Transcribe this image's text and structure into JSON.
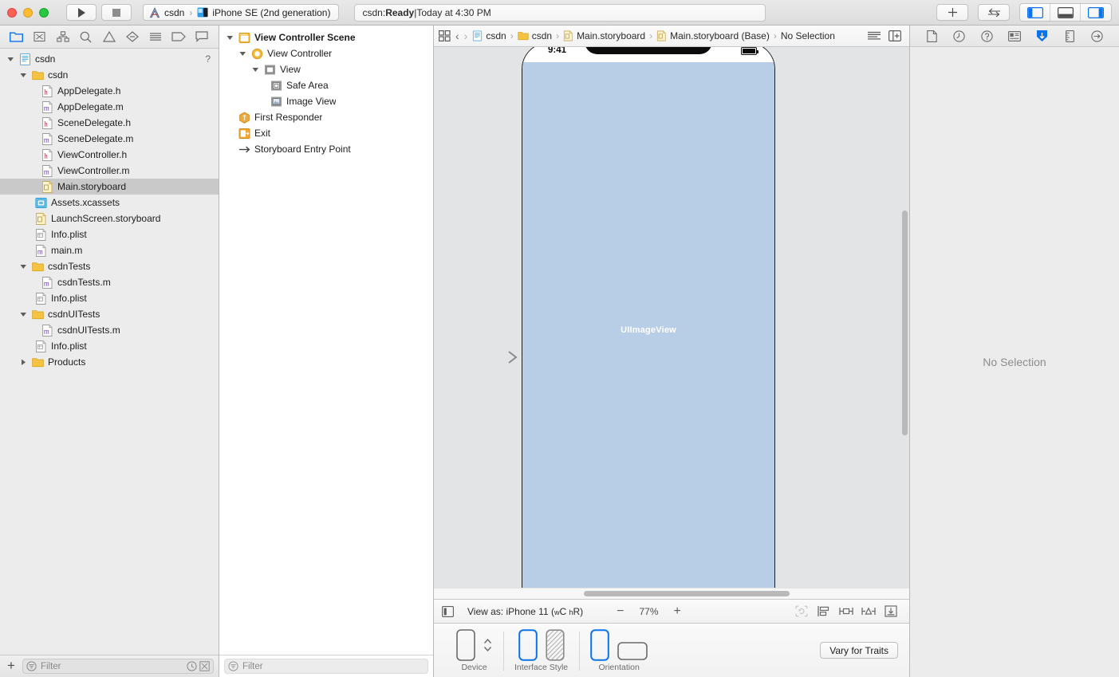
{
  "titlebar": {
    "window_controls": [
      "close",
      "minimize",
      "zoom"
    ],
    "run_button": "run-icon",
    "stop_button": "stop-icon",
    "scheme": {
      "project": "csdn",
      "separator": "›",
      "destination": "iPhone SE (2nd generation)"
    },
    "status": {
      "prefix": "csdn: ",
      "state": "Ready",
      "divider": " | ",
      "time": "Today at 4:30 PM"
    },
    "add_button": "plus-icon",
    "swap_button": "swap-arrows-icon",
    "panel_toggles": [
      {
        "name": "left-panel-toggle",
        "active": true
      },
      {
        "name": "bottom-panel-toggle",
        "active": false
      },
      {
        "name": "right-panel-toggle",
        "active": true
      }
    ]
  },
  "navigator": {
    "tabs": [
      {
        "name": "project-navigator",
        "icon": "folder-icon",
        "active": true
      },
      {
        "name": "source-control-navigator",
        "icon": "source-control-icon",
        "active": false
      },
      {
        "name": "symbol-navigator",
        "icon": "hierarchy-icon",
        "active": false
      },
      {
        "name": "find-navigator",
        "icon": "search-icon",
        "active": false
      },
      {
        "name": "issue-navigator",
        "icon": "warning-triangle-icon",
        "active": false
      },
      {
        "name": "test-navigator",
        "icon": "diamond-icon",
        "active": false
      },
      {
        "name": "debug-navigator",
        "icon": "lines-icon",
        "active": false
      },
      {
        "name": "breakpoint-navigator",
        "icon": "tag-icon",
        "active": false
      },
      {
        "name": "report-navigator",
        "icon": "speech-bubble-icon",
        "active": false
      }
    ],
    "help_marker": "?",
    "tree": [
      {
        "label": "csdn",
        "depth": 0,
        "icon": "project-icon",
        "twisty": "open",
        "selected": false,
        "help": true
      },
      {
        "label": "csdn",
        "depth": 1,
        "icon": "folder-icon",
        "twisty": "open",
        "selected": false
      },
      {
        "label": "AppDelegate.h",
        "depth": 2,
        "icon": "header-icon",
        "twisty": "none",
        "selected": false
      },
      {
        "label": "AppDelegate.m",
        "depth": 2,
        "icon": "source-icon",
        "twisty": "none",
        "selected": false
      },
      {
        "label": "SceneDelegate.h",
        "depth": 2,
        "icon": "header-icon",
        "twisty": "none",
        "selected": false
      },
      {
        "label": "SceneDelegate.m",
        "depth": 2,
        "icon": "source-icon",
        "twisty": "none",
        "selected": false
      },
      {
        "label": "ViewController.h",
        "depth": 2,
        "icon": "header-icon",
        "twisty": "none",
        "selected": false
      },
      {
        "label": "ViewController.m",
        "depth": 2,
        "icon": "source-icon",
        "twisty": "none",
        "selected": false
      },
      {
        "label": "Main.storyboard",
        "depth": 2,
        "icon": "storyboard-icon",
        "twisty": "none",
        "selected": true
      },
      {
        "label": "Assets.xcassets",
        "depth": 2,
        "icon": "assets-icon",
        "twisty": "none",
        "selected": false
      },
      {
        "label": "LaunchScreen.storyboard",
        "depth": 2,
        "icon": "storyboard-icon",
        "twisty": "none",
        "selected": false
      },
      {
        "label": "Info.plist",
        "depth": 2,
        "icon": "plist-icon",
        "twisty": "none",
        "selected": false
      },
      {
        "label": "main.m",
        "depth": 2,
        "icon": "source-icon",
        "twisty": "none",
        "selected": false
      },
      {
        "label": "csdnTests",
        "depth": 1,
        "icon": "folder-icon",
        "twisty": "open",
        "selected": false
      },
      {
        "label": "csdnTests.m",
        "depth": 2,
        "icon": "source-icon",
        "twisty": "none",
        "selected": false
      },
      {
        "label": "Info.plist",
        "depth": 2,
        "icon": "plist-icon",
        "twisty": "none",
        "selected": false
      },
      {
        "label": "csdnUITests",
        "depth": 1,
        "icon": "folder-icon",
        "twisty": "open",
        "selected": false
      },
      {
        "label": "csdnUITests.m",
        "depth": 2,
        "icon": "source-icon",
        "twisty": "none",
        "selected": false
      },
      {
        "label": "Info.plist",
        "depth": 2,
        "icon": "plist-icon",
        "twisty": "none",
        "selected": false
      },
      {
        "label": "Products",
        "depth": 1,
        "icon": "folder-icon",
        "twisty": "closed",
        "selected": false
      }
    ],
    "footer": {
      "add_label": "+",
      "filter_placeholder": "Filter",
      "filter_value": ""
    }
  },
  "outline": {
    "tree": [
      {
        "label": "View Controller Scene",
        "depth": 0,
        "icon": "scene-icon",
        "twisty": "open",
        "bold": true
      },
      {
        "label": "View Controller",
        "depth": 1,
        "icon": "viewcontroller-icon",
        "twisty": "open",
        "bold": false
      },
      {
        "label": "View",
        "depth": 2,
        "icon": "view-icon",
        "twisty": "open",
        "bold": false
      },
      {
        "label": "Safe Area",
        "depth": 3,
        "icon": "safearea-icon",
        "twisty": "none",
        "bold": false
      },
      {
        "label": "Image View",
        "depth": 3,
        "icon": "imageview-icon",
        "twisty": "none",
        "bold": false
      },
      {
        "label": "First Responder",
        "depth": 1,
        "icon": "firstresponder-icon",
        "twisty": "none",
        "bold": false
      },
      {
        "label": "Exit",
        "depth": 1,
        "icon": "exit-icon",
        "twisty": "none",
        "bold": false
      },
      {
        "label": "Storyboard Entry Point",
        "depth": 1,
        "icon": "entrypoint-arrow-icon",
        "twisty": "none",
        "bold": false
      }
    ],
    "footer": {
      "filter_placeholder": "Filter",
      "filter_value": ""
    }
  },
  "jumpbar": {
    "related_items_icon": "related-items-icon",
    "back_icon": "chevron-left-icon",
    "forward_icon": "chevron-right-icon",
    "crumbs": [
      {
        "label": "csdn",
        "icon": "project-icon"
      },
      {
        "label": "csdn",
        "icon": "folder-icon"
      },
      {
        "label": "Main.storyboard",
        "icon": "storyboard-icon"
      },
      {
        "label": "Main.storyboard (Base)",
        "icon": "storyboard-icon"
      },
      {
        "label": "No Selection",
        "icon": "none"
      }
    ],
    "separator": "›",
    "right_icons": [
      {
        "name": "minimap-toggle",
        "icon": "lines-icon"
      },
      {
        "name": "assistant-editor-toggle",
        "icon": "add-editor-icon"
      }
    ]
  },
  "canvas": {
    "device_status_time": "9:41",
    "imageview_label": "UIImageView",
    "entry_point_arrow": "entry-arrow-icon"
  },
  "canvas_bar": {
    "outline_toggle_icon": "document-outline-icon",
    "view_as_prefix": "View as: ",
    "view_as_device": "iPhone 11",
    "trait_w_small": "w",
    "trait_w": "C",
    "trait_h_small": "h",
    "trait_h": "R",
    "zoom_out": "−",
    "zoom_value": "77%",
    "zoom_in": "+",
    "tools": [
      {
        "name": "update-frames-button",
        "icon": "update-frames-icon",
        "disabled": true
      },
      {
        "name": "align-button",
        "icon": "align-icon",
        "disabled": false
      },
      {
        "name": "add-constraints-button",
        "icon": "pin-icon",
        "disabled": false
      },
      {
        "name": "resolve-issues-button",
        "icon": "resolve-issues-icon",
        "disabled": false
      },
      {
        "name": "embed-in-button",
        "icon": "embed-in-icon",
        "disabled": false
      }
    ]
  },
  "device_bar": {
    "groups": [
      {
        "name": "device",
        "label": "Device"
      },
      {
        "name": "interface-style",
        "label": "Interface Style"
      },
      {
        "name": "orientation",
        "label": "Orientation"
      }
    ],
    "vary_button": "Vary for Traits"
  },
  "inspector": {
    "tabs": [
      {
        "name": "file-inspector",
        "icon": "document-icon",
        "active": false
      },
      {
        "name": "history-inspector",
        "icon": "clock-icon",
        "active": false
      },
      {
        "name": "quick-help-inspector",
        "icon": "question-circle-icon",
        "active": false
      },
      {
        "name": "identity-inspector",
        "icon": "identity-card-icon",
        "active": false
      },
      {
        "name": "attributes-inspector",
        "icon": "attributes-icon",
        "active": true
      },
      {
        "name": "size-inspector",
        "icon": "ruler-icon",
        "active": false
      },
      {
        "name": "connections-inspector",
        "icon": "arrow-circle-icon",
        "active": false
      }
    ],
    "empty_state": "No Selection"
  },
  "colors": {
    "accent": "#0a72ec",
    "selection": "#c9c9c9",
    "imageview_fill": "#b8cde6",
    "folder": "#f5c344",
    "canvas_bg": "#e2e4e6"
  }
}
